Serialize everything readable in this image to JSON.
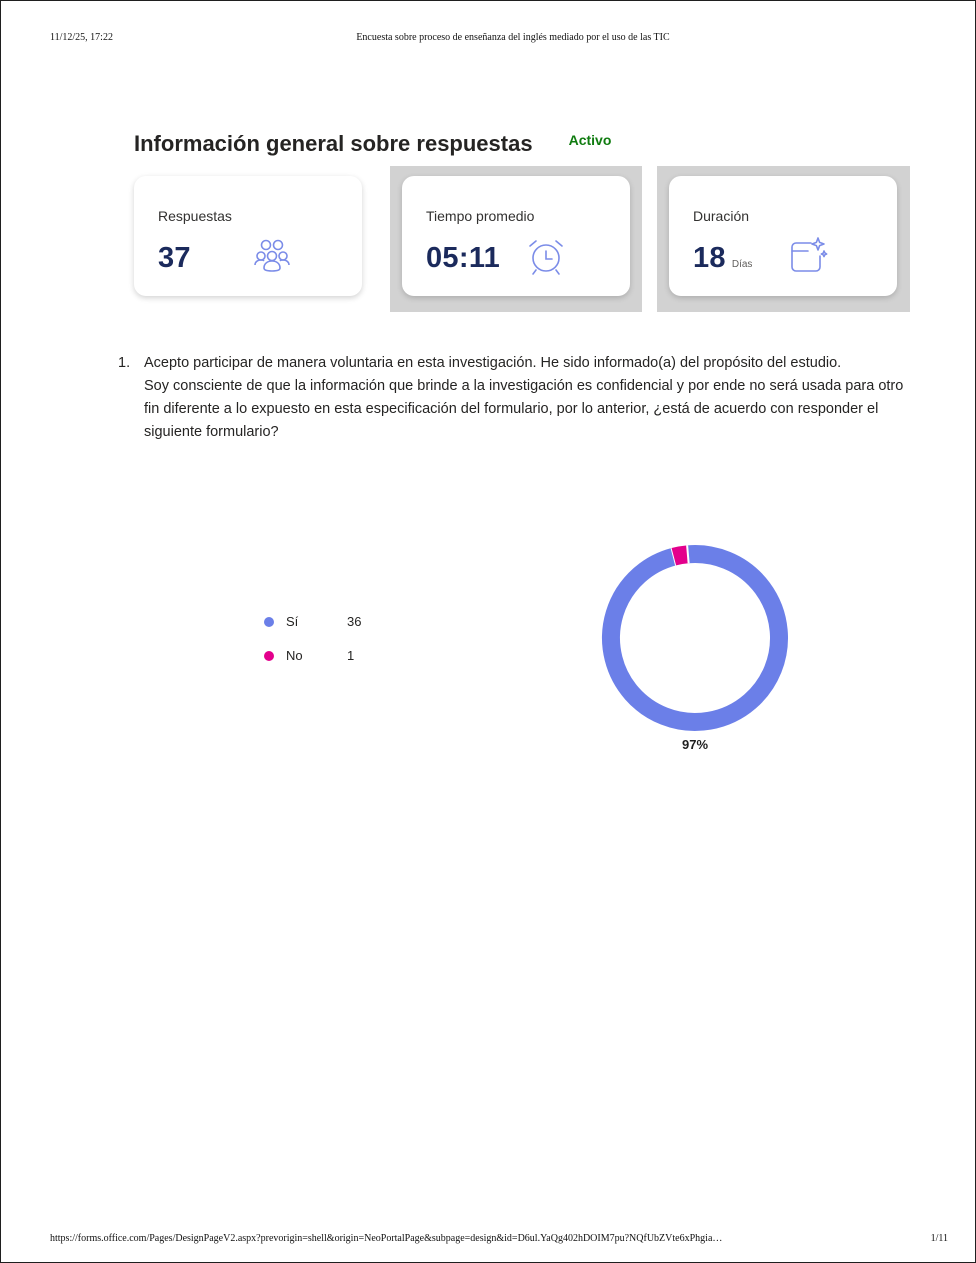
{
  "print_header": {
    "timestamp": "11/12/25, 17:22",
    "document_title": "Encuesta sobre proceso de enseñanza del inglés mediado por el uso de las TIC"
  },
  "print_footer": {
    "url": "https://forms.office.com/Pages/DesignPageV2.aspx?prevorigin=shell&origin=NeoPortalPage&subpage=design&id=D6ul.YaQg402hDOIM7pu?NQfUbZVte6xPhgia…",
    "page_indicator": "1/11"
  },
  "summary": {
    "title": "Información general sobre respuestas",
    "status": "Activo",
    "status_color": "#107c10",
    "cards": [
      {
        "label": "Respuestas",
        "value": "37",
        "unit": "",
        "icon": "people-icon"
      },
      {
        "label": "Tiempo promedio",
        "value": "05:11",
        "unit": "",
        "icon": "alarm-clock-icon"
      },
      {
        "label": "Duración",
        "value": "18",
        "unit": "Días",
        "icon": "calendar-sparkle-icon"
      }
    ]
  },
  "question": {
    "number": "1.",
    "text_line1": "Acepto participar de manera voluntaria en esta investigación. He sido informado(a) del propósito del estudio.",
    "text_line2": "Soy consciente de que la información que brinde a la investigación es confidencial y por ende no será usada para otro fin diferente a lo expuesto en esta especificación del formulario, por lo anterior, ¿está de acuerdo con responder el siguiente formulario?"
  },
  "chart_data": {
    "type": "pie",
    "style": "donut",
    "categories": [
      "Sí",
      "No"
    ],
    "values": [
      36,
      1
    ],
    "colors": [
      "#6b7fe8",
      "#e3008c"
    ],
    "center_label": "97%",
    "legend_position": "left"
  }
}
